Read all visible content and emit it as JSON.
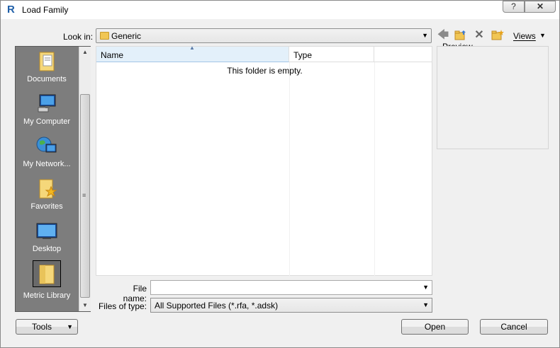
{
  "window": {
    "title": "Load Family",
    "help_label": "?",
    "close_label": "✕"
  },
  "look_in": {
    "label": "Look in:",
    "value": "Generic"
  },
  "toolbar": {
    "views_label": "Views"
  },
  "places": [
    {
      "label": "Documents",
      "icon": "documents-folder-icon"
    },
    {
      "label": "My Computer",
      "icon": "computer-icon"
    },
    {
      "label": "My Network...",
      "icon": "network-globe-icon"
    },
    {
      "label": "Favorites",
      "icon": "favorites-folder-icon"
    },
    {
      "label": "Desktop",
      "icon": "desktop-icon"
    },
    {
      "label": "Metric Library",
      "icon": "folder-icon",
      "selected": true
    }
  ],
  "file_list": {
    "columns": [
      "Name",
      "Type"
    ],
    "empty_message": "This folder is empty."
  },
  "preview": {
    "label": "Preview"
  },
  "file_name": {
    "label": "File name:",
    "value": ""
  },
  "file_type": {
    "label": "Files of type:",
    "value": "All Supported Files  (*.rfa, *.adsk)"
  },
  "buttons": {
    "tools": "Tools",
    "open": "Open",
    "cancel": "Cancel"
  }
}
